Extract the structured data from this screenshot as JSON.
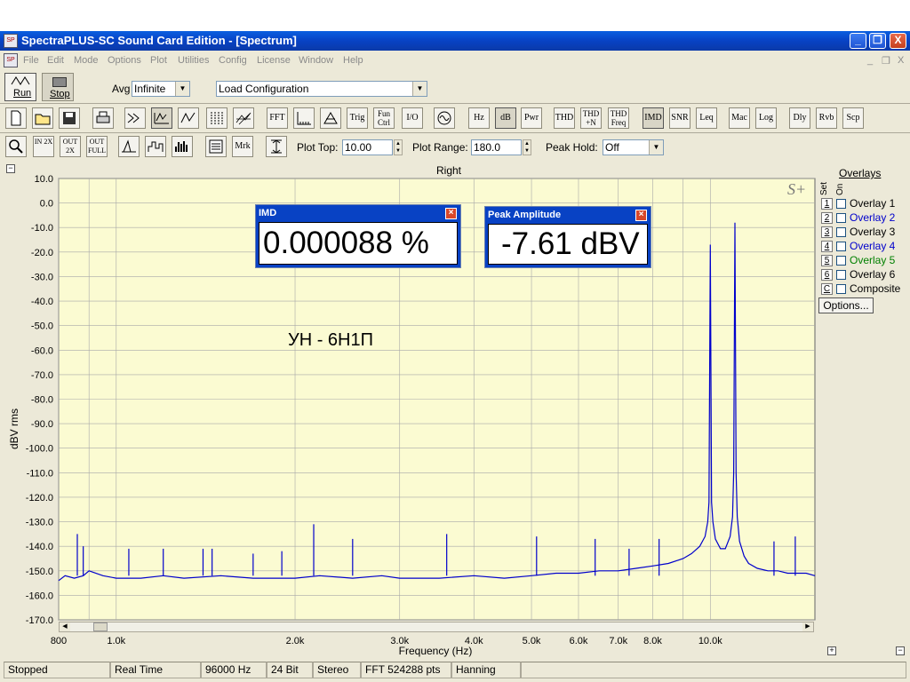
{
  "window": {
    "title": "SpectraPLUS-SC Sound Card Edition - [Spectrum]",
    "app_icon": "spectraplus-app-icon",
    "controls": [
      "_",
      "❐",
      "X"
    ],
    "mdi_controls": [
      "_",
      "❐",
      "X"
    ]
  },
  "menu": [
    "File",
    "Edit",
    "Mode",
    "Options",
    "Plot",
    "Utilities",
    "Config",
    "License",
    "Window",
    "Help"
  ],
  "toolbar1": {
    "run_label": "Run",
    "stop_label": "Stop",
    "avg_label": "Avg",
    "avg_value": "Infinite",
    "config_value": "Load Configuration"
  },
  "toolbar2": {
    "text_buttons": [
      "FFT",
      "Trig",
      "Fun Ctrl",
      "I/O",
      "Hz",
      "dB",
      "Pwr",
      "THD",
      "THD +N",
      "THD Freq",
      "IMD",
      "SNR",
      "Leq",
      "Mac",
      "Log",
      "Dly",
      "Rvb",
      "Scp"
    ],
    "icons": [
      "new-file-icon",
      "open-folder-icon",
      "save-icon",
      "print-icon",
      "signal-generator-icon",
      "spectrum-mode-icon",
      "time-series-icon",
      "spectrogram-icon",
      "3d-surface-icon",
      "fft-window-icon",
      "phase-icon",
      "sine-icon"
    ]
  },
  "toolbar3": {
    "zoom_labels": [
      "IN 2X",
      "OUT 2X",
      "OUT FULL"
    ],
    "mrk_label": "Mrk",
    "plot_top_label": "Plot Top:",
    "plot_top_value": "10.00",
    "plot_range_label": "Plot Range:",
    "plot_range_value": "180.0",
    "peak_hold_label": "Peak Hold:",
    "peak_hold_value": "Off"
  },
  "plot": {
    "channel_title": "Right",
    "annotation": "УН - 6Н1П",
    "watermark": "S+",
    "y_label": "dBV rms",
    "x_label": "Frequency (Hz)"
  },
  "chart_data": {
    "type": "line",
    "title": "Right",
    "xlabel": "Frequency (Hz)",
    "ylabel": "dBV rms",
    "x_scale": "log",
    "xlim": [
      800,
      15000
    ],
    "ylim": [
      -170,
      10
    ],
    "x_ticks": [
      {
        "v": 800,
        "label": "800"
      },
      {
        "v": 1000,
        "label": "1.0k"
      },
      {
        "v": 2000,
        "label": "2.0k"
      },
      {
        "v": 3000,
        "label": "3.0k"
      },
      {
        "v": 4000,
        "label": "4.0k"
      },
      {
        "v": 5000,
        "label": "5.0k"
      },
      {
        "v": 6000,
        "label": "6.0k"
      },
      {
        "v": 7000,
        "label": "7.0k"
      },
      {
        "v": 8000,
        "label": "8.0k"
      },
      {
        "v": 10000,
        "label": "10.0k"
      }
    ],
    "x_gridlines": [
      900,
      9000
    ],
    "y_ticks": [
      10,
      0,
      -10,
      -20,
      -30,
      -40,
      -50,
      -60,
      -70,
      -80,
      -90,
      -100,
      -110,
      -120,
      -130,
      -140,
      -150,
      -160,
      -170
    ],
    "grid": true,
    "series_color": "#0000cc",
    "series": [
      {
        "x": [
          800,
          820,
          850,
          880,
          900,
          950,
          1000,
          1100,
          1200,
          1300,
          1500,
          1700,
          2000,
          2200,
          2500,
          2800,
          3000,
          3500,
          4000,
          4500,
          5000,
          5500,
          6000,
          6500,
          7000,
          7500,
          8000,
          8500,
          9000,
          9300,
          9600,
          9800,
          9900,
          9950,
          10000,
          10050,
          10100,
          10200,
          10400,
          10600,
          10800,
          10900,
          10950,
          11000,
          11050,
          11100,
          11200,
          11400,
          11600,
          12000,
          12500,
          13000,
          13500,
          14000,
          14500,
          15000
        ],
        "y": [
          -154,
          -152,
          -153,
          -152,
          -150,
          -152,
          -153,
          -153,
          -152,
          -153,
          -152,
          -153,
          -153,
          -152,
          -153,
          -152,
          -153,
          -153,
          -152,
          -153,
          -152,
          -151,
          -151,
          -150,
          -150,
          -149,
          -148,
          -147,
          -145,
          -143,
          -140,
          -136,
          -130,
          -122,
          -17,
          -122,
          -130,
          -137,
          -141,
          -141,
          -136,
          -128,
          -110,
          -8,
          -110,
          -128,
          -138,
          -144,
          -147,
          -149,
          -150,
          -150,
          -151,
          -151,
          -151,
          -152
        ]
      }
    ],
    "spurs": [
      {
        "x": 860,
        "y": -135
      },
      {
        "x": 880,
        "y": -140
      },
      {
        "x": 1050,
        "y": -141
      },
      {
        "x": 1200,
        "y": -141
      },
      {
        "x": 1400,
        "y": -141
      },
      {
        "x": 1450,
        "y": -141
      },
      {
        "x": 1700,
        "y": -143
      },
      {
        "x": 1900,
        "y": -142
      },
      {
        "x": 2150,
        "y": -131
      },
      {
        "x": 2500,
        "y": -137
      },
      {
        "x": 3600,
        "y": -135
      },
      {
        "x": 5100,
        "y": -136
      },
      {
        "x": 6400,
        "y": -137
      },
      {
        "x": 7300,
        "y": -141
      },
      {
        "x": 8200,
        "y": -137
      },
      {
        "x": 12800,
        "y": -138
      },
      {
        "x": 13900,
        "y": -136
      }
    ],
    "legend_position": "right"
  },
  "overlays": {
    "title": "Overlays",
    "set_header": "Set",
    "on_header": "On",
    "items": [
      {
        "num": "1",
        "label": "Overlay 1",
        "color": "#000000"
      },
      {
        "num": "2",
        "label": "Overlay 2",
        "color": "#0000cc"
      },
      {
        "num": "3",
        "label": "Overlay 3",
        "color": "#000000"
      },
      {
        "num": "4",
        "label": "Overlay 4",
        "color": "#0000cc"
      },
      {
        "num": "5",
        "label": "Overlay 5",
        "color": "#008000"
      },
      {
        "num": "6",
        "label": "Overlay 6",
        "color": "#000000"
      },
      {
        "num": "C",
        "label": "Composite",
        "color": "#000000"
      }
    ],
    "options_label": "Options..."
  },
  "readouts": {
    "imd": {
      "title": "IMD",
      "value": "0.000088 %"
    },
    "peak": {
      "title": "Peak Amplitude",
      "value": "-7.61 dBV"
    }
  },
  "status": [
    "Stopped",
    "Real Time",
    "96000 Hz",
    "24 Bit",
    "Stereo",
    "FFT 524288 pts",
    "Hanning"
  ]
}
